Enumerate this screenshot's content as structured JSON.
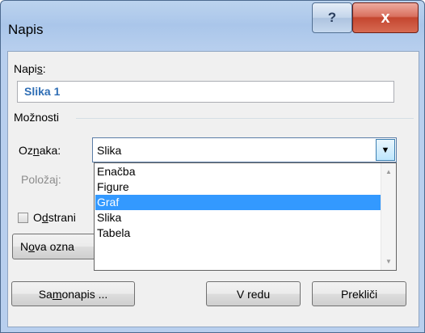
{
  "window": {
    "title": "Napis",
    "help_label": "?",
    "close_label": "x"
  },
  "caption": {
    "label_prefix": "Napi",
    "label_underline": "s",
    "label_suffix": ":",
    "value": "Slika 1"
  },
  "options": {
    "section_label": "Možnosti",
    "label_field": {
      "label_prefix": "Oz",
      "label_underline": "n",
      "label_suffix": "aka:",
      "value": "Slika"
    },
    "position_field": {
      "label": "Položaj:"
    },
    "dropdown_items": [
      {
        "text": "Enačba",
        "selected": false
      },
      {
        "text": "Figure",
        "selected": false
      },
      {
        "text": "Graf",
        "selected": true
      },
      {
        "text": "Slika",
        "selected": false
      },
      {
        "text": "Tabela",
        "selected": false
      }
    ],
    "exclude_checkbox": {
      "prefix": "O",
      "underline": "d",
      "suffix": "strani"
    },
    "new_label_button": {
      "prefix": "N",
      "underline": "o",
      "suffix": "va ozna"
    }
  },
  "buttons": {
    "autocaption": {
      "prefix": "Sa",
      "underline": "m",
      "suffix": "onapis ..."
    },
    "ok": "V redu",
    "cancel": "Prekliči"
  },
  "icons": {
    "help": "help-icon",
    "close": "close-icon",
    "dropdown": "chevron-down-icon",
    "scroll_up": "scroll-up-arrow-icon",
    "scroll_down": "scroll-down-arrow-icon"
  },
  "colors": {
    "titlebar": "#aac6ea",
    "selection": "#3399ff",
    "caption_text": "#2f6eb5",
    "close_button": "#c4462f"
  }
}
